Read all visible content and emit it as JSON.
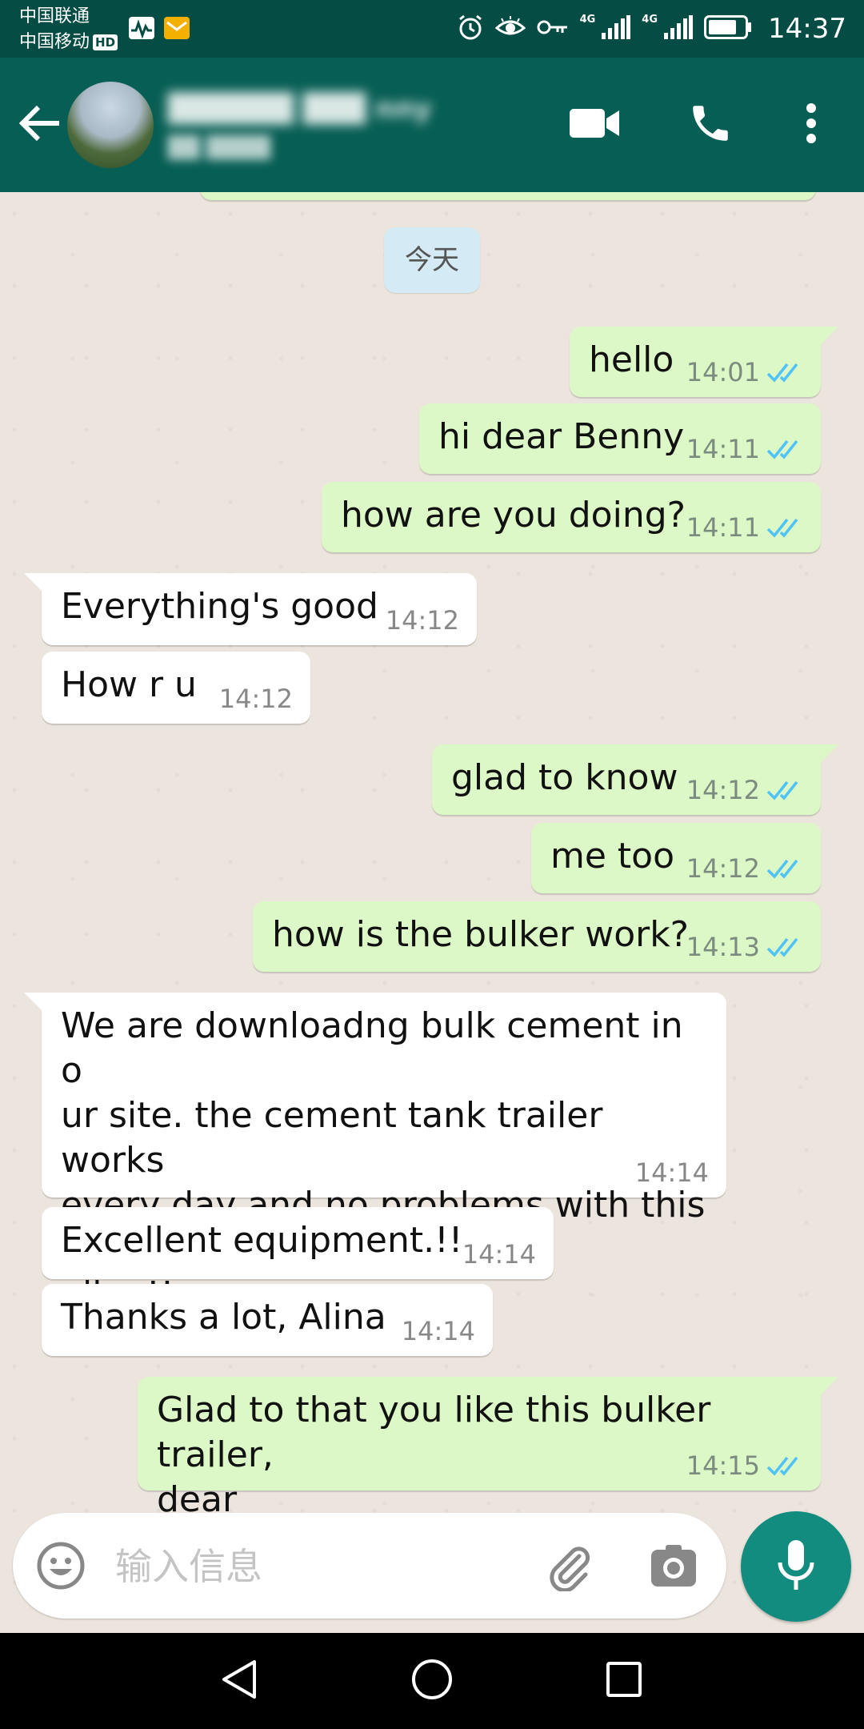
{
  "status_bar": {
    "carrier_1": "中国联通",
    "carrier_2": "中国移动",
    "hd": "HD",
    "network_1": "4G",
    "network_2": "4G",
    "time": "14:37",
    "icons": [
      "pulse-icon",
      "mail-icon",
      "alarm-icon",
      "eye-icon",
      "key-icon",
      "signal-icon",
      "signal-icon",
      "battery-icon"
    ]
  },
  "header": {
    "contact_name": "██████ ███ nny",
    "contact_status": "██ ████",
    "icons": [
      "back-arrow-icon",
      "video-call-icon",
      "phone-call-icon",
      "more-vert-icon"
    ]
  },
  "chat": {
    "date_label": "今天",
    "messages": [
      {
        "dir": "out",
        "text": "hello",
        "time": "14:01"
      },
      {
        "dir": "out",
        "text": "hi dear Benny",
        "time": "14:11"
      },
      {
        "dir": "out",
        "text": "how are you doing?",
        "time": "14:11"
      },
      {
        "dir": "in",
        "text": "Everything's good",
        "time": "14:12"
      },
      {
        "dir": "in",
        "text": "How r u",
        "time": "14:12"
      },
      {
        "dir": "out",
        "text": "glad to know",
        "time": "14:12"
      },
      {
        "dir": "out",
        "text": "me too",
        "time": "14:12"
      },
      {
        "dir": "out",
        "text": "how is the bulker work?",
        "time": "14:13"
      },
      {
        "dir": "in",
        "text": "We are downloadng bulk cement in o\nur site. the cement tank trailer works\nevery day and no problems with this tr\nailer.!!",
        "time": "14:14"
      },
      {
        "dir": "in",
        "text": "Excellent equipment.!!",
        "time": "14:14"
      },
      {
        "dir": "in",
        "text": "Thanks a lot, Alina",
        "time": "14:14"
      },
      {
        "dir": "out",
        "text": "Glad to that you like this bulker trailer,\ndear",
        "time": "14:15"
      }
    ]
  },
  "input": {
    "placeholder": "输入信息",
    "value": ""
  },
  "colors": {
    "header": "#075e54",
    "status_bar": "#054d44",
    "out_bubble": "#dcf8c6",
    "in_bubble": "#ffffff",
    "read_tick": "#4fc3f7",
    "mic_button": "#128c7e"
  },
  "nav": {
    "icons": [
      "back-triangle-icon",
      "home-circle-icon",
      "recents-square-icon"
    ]
  }
}
